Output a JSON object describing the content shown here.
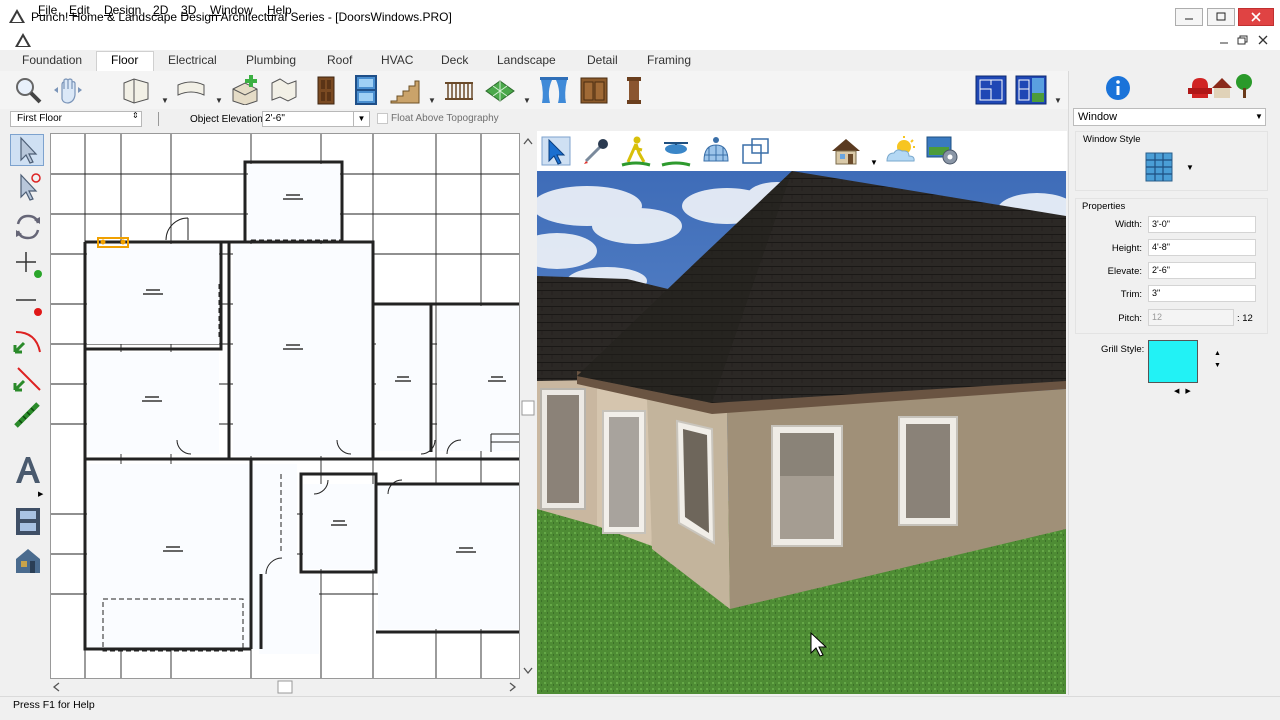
{
  "window": {
    "title": "Punch! Home & Landscape Design Architectural Series - [DoorsWindows.PRO]"
  },
  "menu": {
    "items": [
      {
        "label": "File",
        "accel": "F",
        "rest": "ile"
      },
      {
        "label": "Edit",
        "accel": "E",
        "rest": "dit"
      },
      {
        "label": "Design",
        "accel": "D",
        "rest": "esign"
      },
      {
        "label": "2D",
        "accel": "2",
        "rest": "D"
      },
      {
        "label": "3D",
        "accel": "3",
        "rest": "D"
      },
      {
        "label": "Window",
        "accel": "W",
        "rest": "indow"
      },
      {
        "label": "Help",
        "accel": "H",
        "rest": "elp"
      }
    ]
  },
  "tabs": [
    "Foundation",
    "Floor",
    "Electrical",
    "Plumbing",
    "Roof",
    "HVAC",
    "Deck",
    "Landscape",
    "Detail",
    "Framing"
  ],
  "active_tab": "Floor",
  "toolbar": {
    "icons": [
      "zoom-icon",
      "pan-icon",
      "wall-icon",
      "curved-wall-icon",
      "room-icon",
      "polyline-room-icon",
      "door-icon",
      "window-icon",
      "stairs-icon",
      "railing-icon",
      "floor-pattern-icon",
      "curtain-icon",
      "cabinet-icon",
      "column-icon",
      "plan-view-icon",
      "split-view-icon"
    ]
  },
  "options": {
    "floor_value": "First Floor",
    "object_elevation_label": "Object Elevation:",
    "object_elevation_value": "2'-6\"",
    "float_label": "Float Above Topography"
  },
  "view3d_toolbar": {
    "icons": [
      "select-3d-icon",
      "eyedropper-icon",
      "walkthrough-icon",
      "aerial-icon",
      "orbit-icon",
      "render-view-icon",
      "house-view-icon",
      "lighting-icon",
      "render-settings-icon"
    ]
  },
  "right_panel": {
    "object_type": "Window",
    "window_style_label": "Window Style",
    "properties_label": "Properties",
    "width_label": "Width:",
    "width_value": "3'-0\"",
    "height_label": "Height:",
    "height_value": "4'-8\"",
    "elevate_label": "Elevate:",
    "elevate_value": "2'-6\"",
    "trim_label": "Trim:",
    "trim_value": "3\"",
    "pitch_label": "Pitch:",
    "pitch_value": "12",
    "pitch_suffix": ": 12",
    "grill_label": "Grill Style:",
    "grill_color": "#22f2f5"
  },
  "status": {
    "text": "Press F1 for Help"
  }
}
